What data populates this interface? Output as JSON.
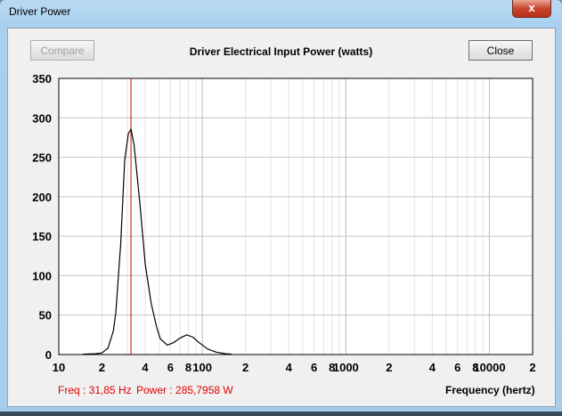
{
  "window": {
    "title": "Driver Power",
    "close_glyph": "x"
  },
  "toolbar": {
    "compare_label": "Compare",
    "close_label": "Close"
  },
  "readout": {
    "freq": "Freq : 31,85 Hz",
    "power": "Power : 285,7958 W"
  },
  "chart_data": {
    "type": "line",
    "title": "Driver Electrical Input Power (watts)",
    "xlabel": "Frequency (hertz)",
    "ylabel": "",
    "xscale": "log",
    "xlim": [
      10,
      20000
    ],
    "ylim": [
      0,
      350
    ],
    "yticks": [
      0,
      50,
      100,
      150,
      200,
      250,
      300,
      350
    ],
    "xtick_labels": [
      {
        "v": 10,
        "t": "10"
      },
      {
        "v": 20,
        "t": "2"
      },
      {
        "v": 40,
        "t": "4"
      },
      {
        "v": 60,
        "t": "6"
      },
      {
        "v": 80,
        "t": "8"
      },
      {
        "v": 100,
        "t": "100"
      },
      {
        "v": 200,
        "t": "2"
      },
      {
        "v": 400,
        "t": "4"
      },
      {
        "v": 600,
        "t": "6"
      },
      {
        "v": 800,
        "t": "8"
      },
      {
        "v": 1000,
        "t": "1000"
      },
      {
        "v": 2000,
        "t": "2"
      },
      {
        "v": 4000,
        "t": "4"
      },
      {
        "v": 6000,
        "t": "6"
      },
      {
        "v": 8000,
        "t": "8"
      },
      {
        "v": 10000,
        "t": "10000"
      },
      {
        "v": 20000,
        "t": "2"
      }
    ],
    "grid": true,
    "cursor_x": 31.85,
    "cursor_color": "#e00000",
    "series": [
      {
        "name": "Power",
        "color": "#000000",
        "x": [
          14.7,
          18,
          20,
          22,
          24,
          25,
          27,
          28.8,
          30.5,
          31.85,
          33.5,
          36.8,
          40,
          44,
          48,
          51,
          57,
          63,
          70,
          78,
          86,
          95,
          109,
          125,
          145,
          160
        ],
        "y": [
          0.5,
          1,
          2,
          8,
          30,
          54,
          140,
          246,
          280,
          285.8,
          265,
          190,
          115,
          65,
          35,
          20,
          12,
          15,
          21,
          25,
          22,
          15,
          7,
          3,
          1,
          0.5
        ]
      }
    ]
  }
}
